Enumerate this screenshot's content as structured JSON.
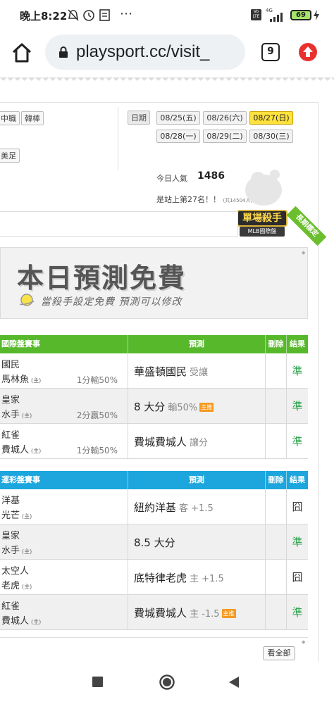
{
  "status_bar": {
    "time": "晚上8:22",
    "icons": [
      "bell-off-icon",
      "alarm-icon",
      "news-icon",
      "more-icon",
      "volte-icon",
      "signal-icon",
      "battery-icon",
      "charging-icon"
    ],
    "more": "⋯",
    "network": "4G",
    "volte": "Vo LTE",
    "battery": "69"
  },
  "browser": {
    "url": "playsport.cc/visit_",
    "tab_count": "9"
  },
  "filters": {
    "tags": [
      "中職",
      "韓棒",
      "美足"
    ],
    "date_label": "日期",
    "dates_row1": [
      "08/25(五)",
      "08/26(六)",
      "08/27(日)"
    ],
    "dates_row2": [
      "08/28(一)",
      "08/29(二)",
      "08/30(三)"
    ],
    "active_date": "08/27(日)"
  },
  "stats": {
    "popularity_label": "今日人氣",
    "popularity_value": "1486",
    "rank_text": "是站上第27名！！",
    "rank_total": "(共14504人)"
  },
  "badge": {
    "title": "單場殺手",
    "subtitle": "MLB國際盤",
    "ribbon": "長期標定"
  },
  "banner": {
    "title": "本日預測免費",
    "subtitle": "當殺手設定免費 預測可以修改"
  },
  "table1": {
    "headers": [
      "國際盤賽事",
      "預測",
      "刪除",
      "結果"
    ],
    "color": "#58b82c",
    "rows": [
      {
        "team1": "國民",
        "team2": "馬林魚",
        "home": "(主)",
        "spread": "1分輸50%",
        "prediction": "華盛頓國民",
        "pred_sub": "受讓",
        "badge": "",
        "result": "準"
      },
      {
        "team1": "皇家",
        "team2": "水手",
        "home": "(主)",
        "spread": "2分贏50%",
        "prediction": "8 大分",
        "pred_sub": "輸50%",
        "badge": "主推",
        "result": "準"
      },
      {
        "team1": "紅雀",
        "team2": "費城人",
        "home": "(主)",
        "spread": "1分輸50%",
        "prediction": "費城費城人",
        "pred_sub": "讓分",
        "badge": "",
        "result": "準"
      }
    ]
  },
  "table2": {
    "headers": [
      "運彩盤賽事",
      "預測",
      "刪除",
      "結果"
    ],
    "color": "#1ca6dd",
    "rows": [
      {
        "team1": "洋基",
        "team2": "光芒",
        "home": "(主)",
        "prediction": "紐約洋基",
        "pred_sub": "客 +1.5",
        "badge": "",
        "result": "囧"
      },
      {
        "team1": "皇家",
        "team2": "水手",
        "home": "(主)",
        "prediction": "8.5 大分",
        "pred_sub": "",
        "badge": "",
        "result": "準"
      },
      {
        "team1": "太空人",
        "team2": "老虎",
        "home": "(主)",
        "prediction": "底特律老虎",
        "pred_sub": "主 +1.5",
        "badge": "",
        "result": "囧"
      },
      {
        "team1": "紅雀",
        "team2": "費城人",
        "home": "(主)",
        "prediction": "費城費城人",
        "pred_sub": "主 -1.5",
        "badge": "主推",
        "result": "準"
      }
    ]
  },
  "see_all": "看全部"
}
